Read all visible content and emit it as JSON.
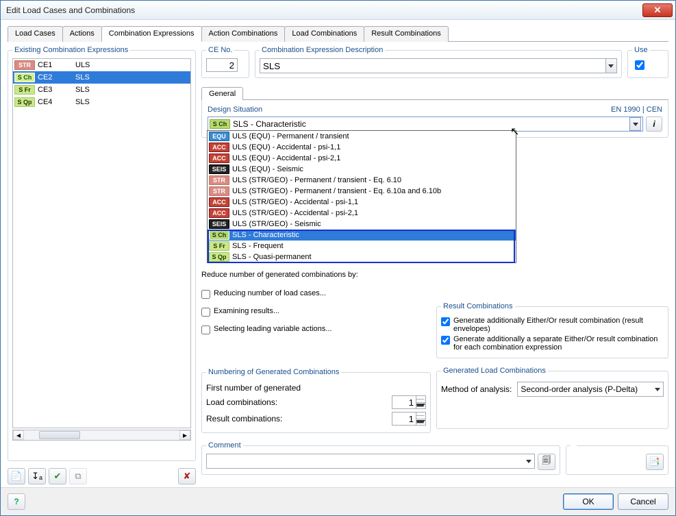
{
  "window": {
    "title": "Edit Load Cases and Combinations"
  },
  "tabs": [
    "Load Cases",
    "Actions",
    "Combination Expressions",
    "Action Combinations",
    "Load Combinations",
    "Result Combinations"
  ],
  "active_tab": 2,
  "left": {
    "title": "Existing Combination Expressions",
    "rows": [
      {
        "badge": "STR",
        "badge_class": "b-str",
        "code": "CE1",
        "desc": "ULS"
      },
      {
        "badge": "S Ch",
        "badge_class": "b-sch",
        "code": "CE2",
        "desc": "SLS"
      },
      {
        "badge": "S Fr",
        "badge_class": "b-sfr",
        "code": "CE3",
        "desc": "SLS"
      },
      {
        "badge": "S Qp",
        "badge_class": "b-sqp",
        "code": "CE4",
        "desc": "SLS"
      }
    ],
    "selected": 1
  },
  "ce_no": {
    "label": "CE No.",
    "value": "2"
  },
  "ced": {
    "label": "Combination Expression Description",
    "value": "SLS"
  },
  "use": {
    "label": "Use",
    "checked": true
  },
  "inner_tab": "General",
  "design_situation": {
    "label": "Design Situation",
    "std": "EN 1990 | CEN",
    "selected_badge": "S Ch",
    "selected_text": "SLS - Characteristic"
  },
  "dropdown_items": [
    {
      "badge": "EQU",
      "bc": "b-equ",
      "text": "ULS (EQU) - Permanent / transient"
    },
    {
      "badge": "ACC",
      "bc": "b-acc",
      "text": "ULS (EQU) - Accidental - psi-1,1"
    },
    {
      "badge": "ACC",
      "bc": "b-acc",
      "text": "ULS (EQU) - Accidental - psi-2,1"
    },
    {
      "badge": "SEIS",
      "bc": "b-seis",
      "text": "ULS (EQU) - Seismic"
    },
    {
      "badge": "STR",
      "bc": "b-str",
      "text": "ULS (STR/GEO) - Permanent / transient - Eq. 6.10"
    },
    {
      "badge": "STR",
      "bc": "b-str",
      "text": "ULS (STR/GEO) - Permanent / transient - Eq. 6.10a and 6.10b"
    },
    {
      "badge": "ACC",
      "bc": "b-acc",
      "text": "ULS (STR/GEO) - Accidental - psi-1,1"
    },
    {
      "badge": "ACC",
      "bc": "b-acc",
      "text": "ULS (STR/GEO) - Accidental - psi-2,1"
    },
    {
      "badge": "SEIS",
      "bc": "b-seis",
      "text": "ULS (STR/GEO) - Seismic"
    },
    {
      "badge": "S Ch",
      "bc": "b-sch",
      "text": "SLS - Characteristic"
    },
    {
      "badge": "S Fr",
      "bc": "b-sfr",
      "text": "SLS - Frequent"
    },
    {
      "badge": "S Qp",
      "bc": "b-sqp",
      "text": "SLS - Quasi-permanent"
    }
  ],
  "dropdown_selected": 9,
  "reduce_header": "Reduce number of generated combinations by:",
  "reduce": {
    "o1": "Reducing number of load cases...",
    "o2": "Examining results...",
    "o3": "Selecting leading variable actions..."
  },
  "result_comb": {
    "title": "Result Combinations",
    "c1": "Generate additionally Either/Or result combination (result envelopes)",
    "c2": "Generate additionally a separate Either/Or result combination for each combination expression"
  },
  "numbering": {
    "title": "Numbering of Generated Combinations",
    "first_label": "First number of generated",
    "load_label": "Load combinations:",
    "load_val": "1",
    "result_label": "Result combinations:",
    "result_val": "1"
  },
  "gen_lc": {
    "title": "Generated Load Combinations",
    "method_label": "Method of analysis:",
    "method_value": "Second-order analysis (P-Delta)"
  },
  "comment": {
    "label": "Comment",
    "value": ""
  },
  "buttons": {
    "ok": "OK",
    "cancel": "Cancel"
  }
}
